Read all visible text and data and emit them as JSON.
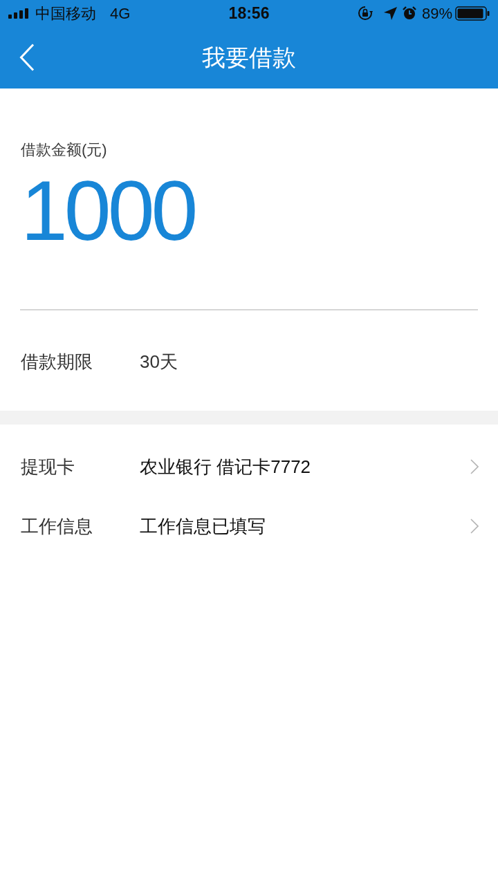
{
  "status_bar": {
    "carrier": "中国移动",
    "network": "4G",
    "time": "18:56",
    "battery": "89%"
  },
  "nav": {
    "title": "我要借款"
  },
  "amount": {
    "label": "借款金额(元)",
    "value": "1000"
  },
  "term": {
    "label": "借款期限",
    "value": "30天"
  },
  "rows": [
    {
      "label": "提现卡",
      "value": "农业银行 借记卡7772"
    },
    {
      "label": "工作信息",
      "value": "工作信息已填写"
    }
  ]
}
